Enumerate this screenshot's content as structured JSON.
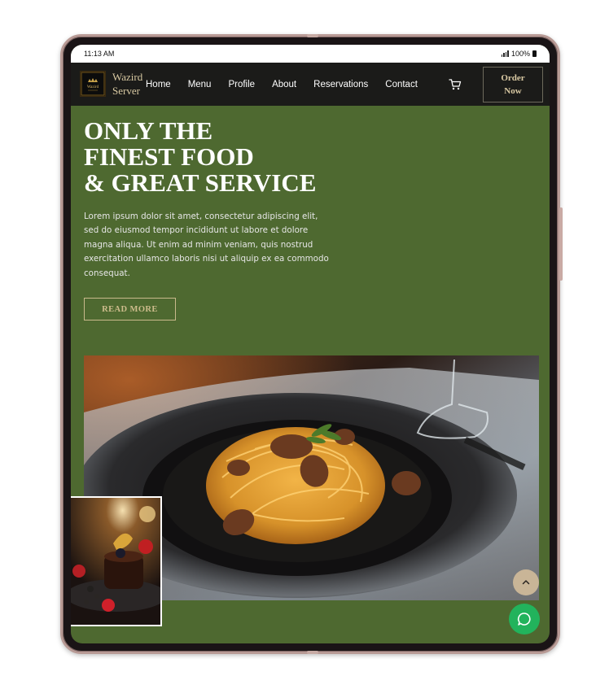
{
  "status_bar": {
    "time": "11:13 AM",
    "battery": "100%"
  },
  "brand": {
    "line1": "Wazird",
    "line2": "Server",
    "logo_text": "Wazird"
  },
  "nav": {
    "items": [
      "Home",
      "Menu",
      "Profile",
      "About",
      "Reservations",
      "Contact"
    ]
  },
  "order_button": {
    "line1": "Order",
    "line2": "Now"
  },
  "hero": {
    "title": "ONLY THE\nFINEST FOOD\n& GREAT SERVICE",
    "text": "Lorem ipsum dolor sit amet, consectetur adipiscing elit, sed do eiusmod tempor incididunt ut labore et dolore magna aliqua. Ut enim ad minim veniam, quis nostrud exercitation ullamco laboris nisi ut aliquip ex ea commodo consequat.",
    "button": "READ MORE"
  },
  "icons": {
    "cart": "cart-icon",
    "scroll_top": "chevron-up-icon",
    "chat": "chat-bubble-icon"
  },
  "colors": {
    "hero_bg": "#4e6930",
    "navbar_bg": "#1b1b19",
    "accent_gold": "#d9c9a3",
    "chat_green": "#22b35c"
  }
}
